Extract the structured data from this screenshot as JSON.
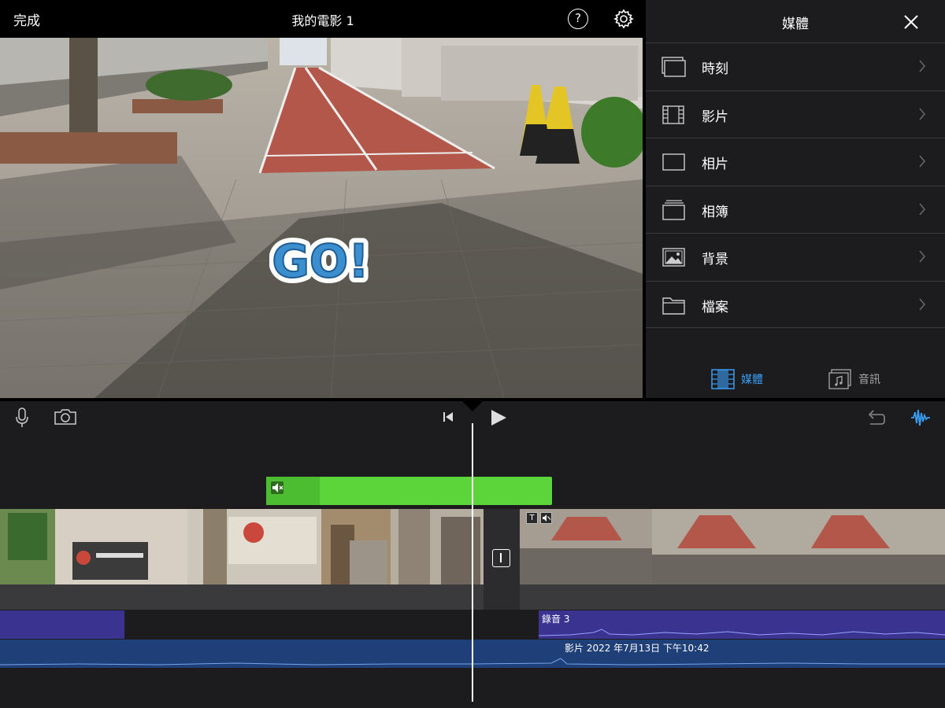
{
  "topbar": {
    "done_label": "完成",
    "movie_title": "我的電影 1",
    "help_glyph": "?",
    "help_icon": "question-circle-icon",
    "settings_icon": "gear-icon"
  },
  "preview": {
    "sticker_text": "GO!"
  },
  "media_panel": {
    "title": "媒體",
    "close_icon": "close-icon",
    "items": [
      {
        "label": "時刻",
        "icon": "stacked-moments-icon"
      },
      {
        "label": "影片",
        "icon": "film-strip-icon"
      },
      {
        "label": "相片",
        "icon": "photo-frame-icon"
      },
      {
        "label": "相簿",
        "icon": "album-stack-icon"
      },
      {
        "label": "背景",
        "icon": "landscape-image-icon"
      },
      {
        "label": "檔案",
        "icon": "folder-icon"
      }
    ],
    "tabs": [
      {
        "label": "媒體",
        "active": true,
        "icon": "film-tab-icon"
      },
      {
        "label": "音訊",
        "active": false,
        "icon": "music-note-icon"
      }
    ],
    "colors": {
      "active_tab": "#3a9df5",
      "inactive_tab": "#a8a8a8"
    }
  },
  "timeline": {
    "toolbar_icons": [
      "microphone-icon",
      "camera-icon",
      "skip-to-start-icon",
      "play-icon",
      "undo-icon",
      "audio-waveform-icon"
    ],
    "clips": {
      "sticker_color": "#5bd53a",
      "recording_label": "錄音 3",
      "background_audio_label": "影片 2022 年7月13日 下午10:42",
      "recording_color": "#3a3390",
      "background_audio_color": "#1f3f78",
      "thumb_text_glyph": "T"
    }
  }
}
